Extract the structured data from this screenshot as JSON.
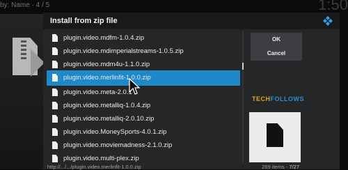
{
  "background": {
    "sort_label": "by: Name · 4 / 5",
    "clock": "1:50"
  },
  "dialog": {
    "title": "Install from zip file",
    "logo_icon": "kodi-logo-icon",
    "files": [
      {
        "name": "plugin.video.mdfm-1.0.4.zip",
        "selected": false
      },
      {
        "name": "plugin.video.mdimperialstreams-1.0.5.zip",
        "selected": false
      },
      {
        "name": "plugin.video.mdm4u-1.1.0.zip",
        "selected": false
      },
      {
        "name": "plugin.video.merlinfit-1.0.0.zip",
        "selected": true
      },
      {
        "name": "plugin.video.meta-2.0.1",
        "selected": false
      },
      {
        "name": "plugin.video.metalliq-1.0.4.zip",
        "selected": false
      },
      {
        "name": "plugin.video.metalliq-2.0.10.zip",
        "selected": false
      },
      {
        "name": "plugin.video.MoneySports-4.0.1.zip",
        "selected": false
      },
      {
        "name": "plugin.video.moviemadness-2.1.0.zip",
        "selected": false
      },
      {
        "name": "plugin.video.multi-plex.zip",
        "selected": false
      }
    ],
    "buttons": {
      "ok": "OK",
      "cancel": "Cancel"
    },
    "watermark": {
      "part1": "TECH",
      "part2": "FOLLOWS"
    },
    "footer": {
      "path": "http://.../.../plugin.video.merlinfit-1.0.0.zip",
      "item_count": "269",
      "items_word": "items",
      "page": "7/27"
    }
  }
}
